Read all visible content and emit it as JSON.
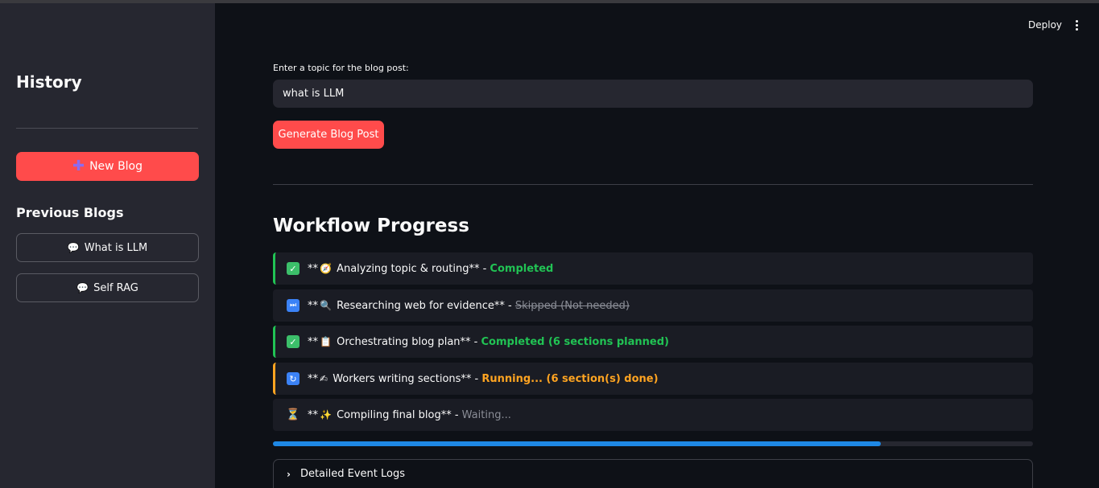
{
  "sidebar": {
    "title": "History",
    "new_blog_label": "New Blog",
    "previous_title": "Previous Blogs",
    "previous_items": [
      {
        "label": "What is LLM"
      },
      {
        "label": "Self RAG"
      }
    ]
  },
  "header": {
    "deploy_label": "Deploy"
  },
  "main": {
    "topic_label": "Enter a topic for the blog post:",
    "topic_value": "what is LLM",
    "generate_label": "Generate Blog Post",
    "workflow_title": "Workflow Progress",
    "steps": [
      {
        "prefix": "**",
        "emoji": "🧭",
        "text": " Analyzing topic & routing** - ",
        "status": "Completed",
        "status_type": "completed"
      },
      {
        "prefix": "**",
        "emoji": "🔍",
        "text": " Researching web for evidence** - ",
        "status": "Skipped (Not needed)",
        "status_type": "skipped"
      },
      {
        "prefix": "**",
        "emoji": "📋",
        "text": " Orchestrating blog plan** - ",
        "status": "Completed (6 sections planned)",
        "status_type": "completed"
      },
      {
        "prefix": "**",
        "emoji": "✍",
        "text": " Workers writing sections** - ",
        "status": "Running... (6 section(s) done)",
        "status_type": "running"
      },
      {
        "prefix": "**",
        "emoji": "✨",
        "text": " Compiling final blog** - ",
        "status": "Waiting...",
        "status_type": "waiting"
      }
    ],
    "progress_fraction": 0.8,
    "event_logs_label": "Detailed Event Logs"
  },
  "colors": {
    "accent": "#ff4b4b",
    "completed": "#21c354",
    "running": "#ffa421",
    "progress": "#1e88e5"
  }
}
